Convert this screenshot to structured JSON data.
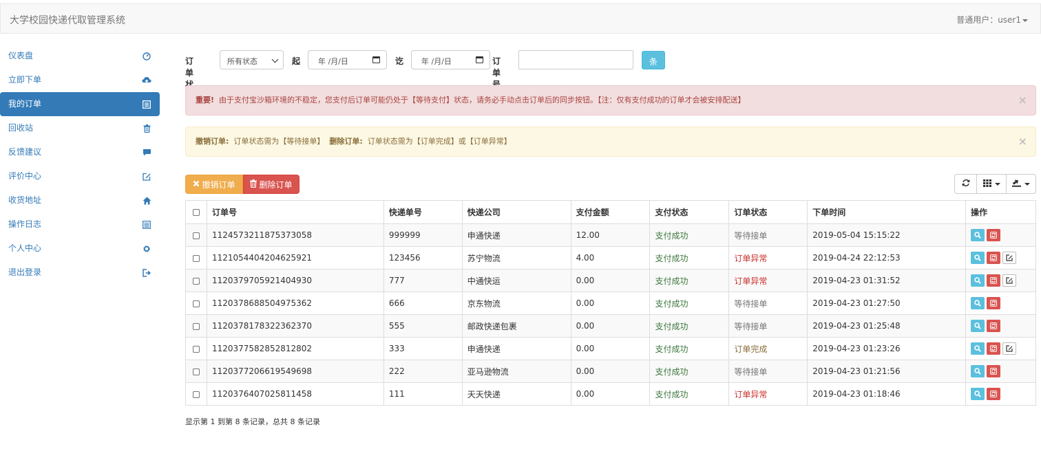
{
  "app": {
    "title": "大学校园快递代取管理系统",
    "user_menu": "普通用户：user1"
  },
  "sidebar": {
    "items": [
      {
        "label": "仪表盘",
        "icon": "dashboard-icon"
      },
      {
        "label": "立即下单",
        "icon": "cloud-upload-icon"
      },
      {
        "label": "我的订单",
        "icon": "list-icon",
        "active": true
      },
      {
        "label": "回收站",
        "icon": "trash-icon"
      },
      {
        "label": "反馈建议",
        "icon": "comment-icon"
      },
      {
        "label": "评价中心",
        "icon": "edit-icon"
      },
      {
        "label": "收货地址",
        "icon": "home-icon"
      },
      {
        "label": "操作日志",
        "icon": "list-alt-icon"
      },
      {
        "label": "个人中心",
        "icon": "cog-icon"
      },
      {
        "label": "退出登录",
        "icon": "log-out-icon"
      }
    ]
  },
  "filter": {
    "status_label": "订单状态",
    "status_value": "所有状态",
    "from_label": "起",
    "date_placeholder": "年 /月/日",
    "to_label": "讫",
    "order_no_label": "订单号",
    "order_no_value": "",
    "query_button": "条件查询"
  },
  "alerts": {
    "danger": {
      "strong": "重要!",
      "text": "由于支付宝沙箱环境的不稳定，您支付后订单可能仍处于【等待支付】状态，请务必手动点击订单后的同步按钮。【注：仅有支付成功的订单才会被安排配送】",
      "close": "×"
    },
    "warning": {
      "strong1": "撤销订单:",
      "text1": "订单状态需为【等待接单】",
      "strong2": "删除订单:",
      "text2": "订单状态需为【订单完成】或【订单异常】",
      "close": "×"
    }
  },
  "toolbar": {
    "cancel_label": "撤销订单",
    "delete_label": "删除订单"
  },
  "table": {
    "headers": [
      "订单号",
      "快递单号",
      "快递公司",
      "支付金额",
      "支付状态",
      "订单状态",
      "下单时间",
      "操作"
    ],
    "rows": [
      {
        "order_no": "1124573211875373058",
        "tracking_no": "999999",
        "company": "申通快递",
        "amount": "12.00",
        "pay_status": "支付成功",
        "order_status": "等待接单",
        "status_type": "grey",
        "time": "2019-05-04 15:15:22",
        "editable": false
      },
      {
        "order_no": "1121054404204625921",
        "tracking_no": "123456",
        "company": "苏宁物流",
        "amount": "4.00",
        "pay_status": "支付成功",
        "order_status": "订单异常",
        "status_type": "red",
        "time": "2019-04-24 22:12:53",
        "editable": true
      },
      {
        "order_no": "1120379705921404930",
        "tracking_no": "777",
        "company": "中通快运",
        "amount": "0.00",
        "pay_status": "支付成功",
        "order_status": "订单异常",
        "status_type": "red",
        "time": "2019-04-23 01:31:52",
        "editable": true
      },
      {
        "order_no": "1120378688504975362",
        "tracking_no": "666",
        "company": "京东物流",
        "amount": "0.00",
        "pay_status": "支付成功",
        "order_status": "等待接单",
        "status_type": "grey",
        "time": "2019-04-23 01:27:50",
        "editable": false
      },
      {
        "order_no": "1120378178322362370",
        "tracking_no": "555",
        "company": "邮政快递包裹",
        "amount": "0.00",
        "pay_status": "支付成功",
        "order_status": "等待接单",
        "status_type": "grey",
        "time": "2019-04-23 01:25:48",
        "editable": false
      },
      {
        "order_no": "1120377582852812802",
        "tracking_no": "333",
        "company": "申通快递",
        "amount": "0.00",
        "pay_status": "支付成功",
        "order_status": "订单完成",
        "status_type": "ok",
        "time": "2019-04-23 01:23:26",
        "editable": true
      },
      {
        "order_no": "1120377206619549698",
        "tracking_no": "222",
        "company": "亚马逊物流",
        "amount": "0.00",
        "pay_status": "支付成功",
        "order_status": "等待接单",
        "status_type": "grey",
        "time": "2019-04-23 01:21:56",
        "editable": false
      },
      {
        "order_no": "1120376407025811458",
        "tracking_no": "111",
        "company": "天天快递",
        "amount": "0.00",
        "pay_status": "支付成功",
        "order_status": "订单异常",
        "status_type": "red",
        "time": "2019-04-23 01:18:46",
        "editable": false
      }
    ]
  },
  "footer": {
    "summary": "显示第 1 到第 8 条记录，总共 8 条记录"
  },
  "colors": {
    "primary": "#337ab7",
    "info": "#5bc0de",
    "warning": "#f0ad4e",
    "danger": "#d9534f",
    "success_text": "#3c763d"
  }
}
